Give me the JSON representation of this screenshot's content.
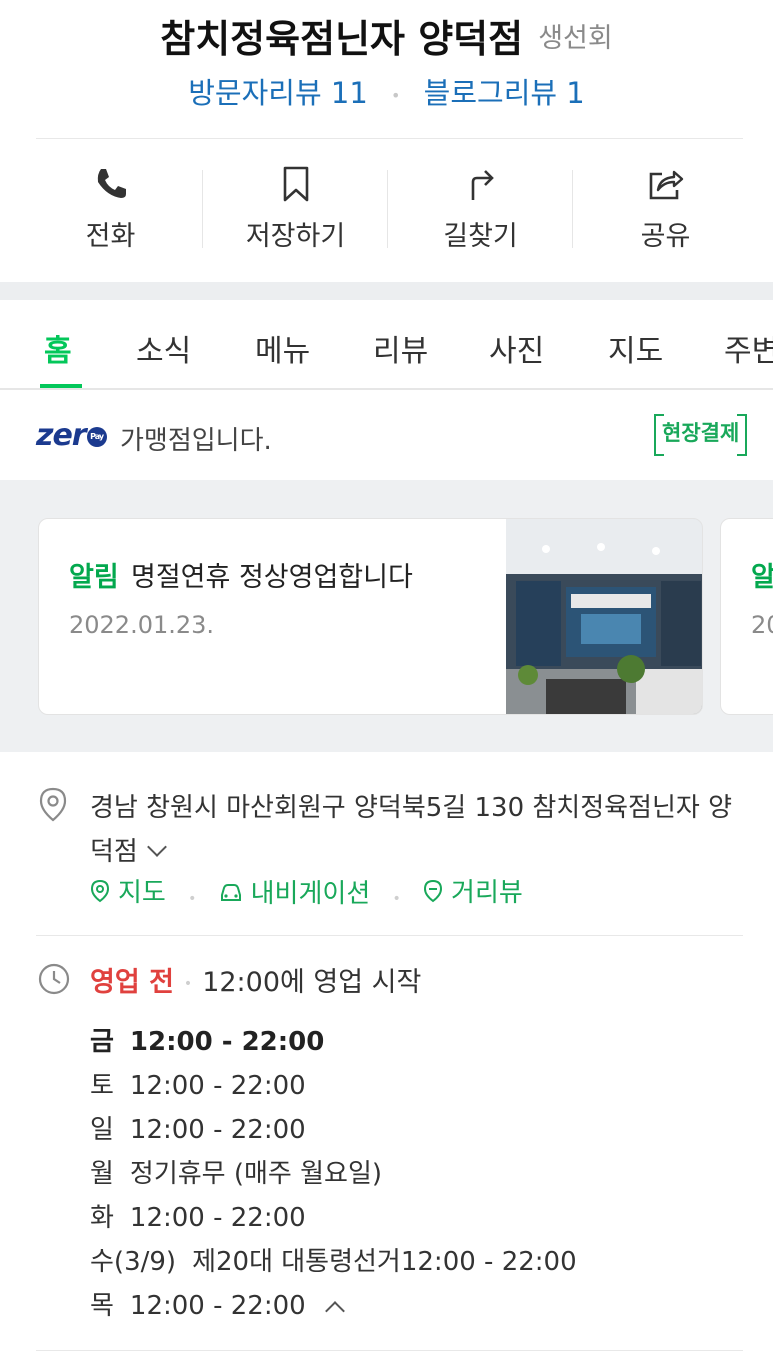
{
  "header": {
    "title": "참치정육점닌자 양덕점",
    "category": "생선회",
    "visitor_reviews": "방문자리뷰 11",
    "blog_reviews": "블로그리뷰 1"
  },
  "actions": [
    {
      "label": "전화",
      "icon": "phone-icon"
    },
    {
      "label": "저장하기",
      "icon": "bookmark-icon"
    },
    {
      "label": "길찾기",
      "icon": "directions-icon"
    },
    {
      "label": "공유",
      "icon": "share-icon"
    }
  ],
  "tabs": [
    "홈",
    "소식",
    "메뉴",
    "리뷰",
    "사진",
    "지도",
    "주변"
  ],
  "active_tab": "홈",
  "zeropay": {
    "logo": "zer",
    "pay_badge": "Pay",
    "text": "가맹점입니다.",
    "onsite_label": "현장결제"
  },
  "news": {
    "tag": "알림",
    "title": "명절연휴 정상영업합니다",
    "date": "2022.01.23.",
    "next_tag": "알",
    "next_date": "20"
  },
  "location": {
    "address": "경남 창원시 마산회원구 양덕북5길 130 참치정육점닌자 양덕점",
    "links": [
      "지도",
      "내비게이션",
      "거리뷰"
    ]
  },
  "business": {
    "status": "영업 전",
    "next": "12:00에 영업 시작",
    "hours": [
      {
        "day": "금",
        "time": "12:00 - 22:00",
        "today": true
      },
      {
        "day": "토",
        "time": "12:00 - 22:00"
      },
      {
        "day": "일",
        "time": "12:00 - 22:00"
      },
      {
        "day": "월",
        "time": "정기휴무 (매주 월요일)"
      },
      {
        "day": "화",
        "time": "12:00 - 22:00"
      },
      {
        "day": "수(3/9)",
        "time": "제20대 대통령선거12:00 - 22:00"
      },
      {
        "day": "목",
        "time": "12:00 - 22:00"
      }
    ]
  },
  "colors": {
    "accent_green": "#03c75a",
    "review_blue": "#1b6fb8",
    "closed_red": "#e0413e"
  }
}
